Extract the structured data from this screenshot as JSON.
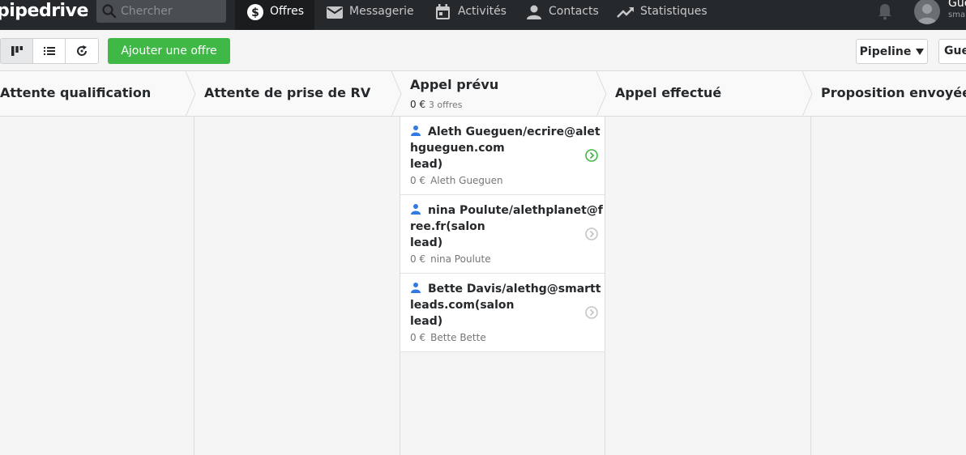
{
  "nav": {
    "logo": "pipedrive",
    "search_placeholder": "Chercher",
    "items": [
      {
        "label": "Offres"
      },
      {
        "label": "Messagerie"
      },
      {
        "label": "Activités"
      },
      {
        "label": "Contacts"
      },
      {
        "label": "Statistiques"
      }
    ],
    "user_name": "Gue",
    "user_sub": "sma"
  },
  "toolbar": {
    "add_label": "Ajouter une offre",
    "pipeline_label": "Pipeline",
    "filter_label": "Gue"
  },
  "stages": [
    {
      "name": "Attente qualification"
    },
    {
      "name": "Attente de prise de RV"
    },
    {
      "name": "Appel prévu",
      "amount": "0 €",
      "count": "3 offres"
    },
    {
      "name": "Appel effectué"
    },
    {
      "name": "Proposition envoyée"
    }
  ],
  "deals": [
    {
      "title": "Aleth Gueguen/ecrire@alethgueguen.com",
      "title_tail": "lead)",
      "amount": "0 €",
      "person": "Aleth Gueguen",
      "status": "active"
    },
    {
      "title": "nina Poulute/alethplanet@free.fr(salon",
      "title_tail": "lead)",
      "amount": "0 €",
      "person": "nina Poulute",
      "status": "inactive"
    },
    {
      "title": "Bette Davis/alethg@smarttleads.com(salon",
      "title_tail": "lead)",
      "amount": "0 €",
      "person": "Bette Bette",
      "status": "inactive"
    }
  ],
  "colors": {
    "accent": "#3fb846",
    "nav_bg": "#26292c"
  }
}
